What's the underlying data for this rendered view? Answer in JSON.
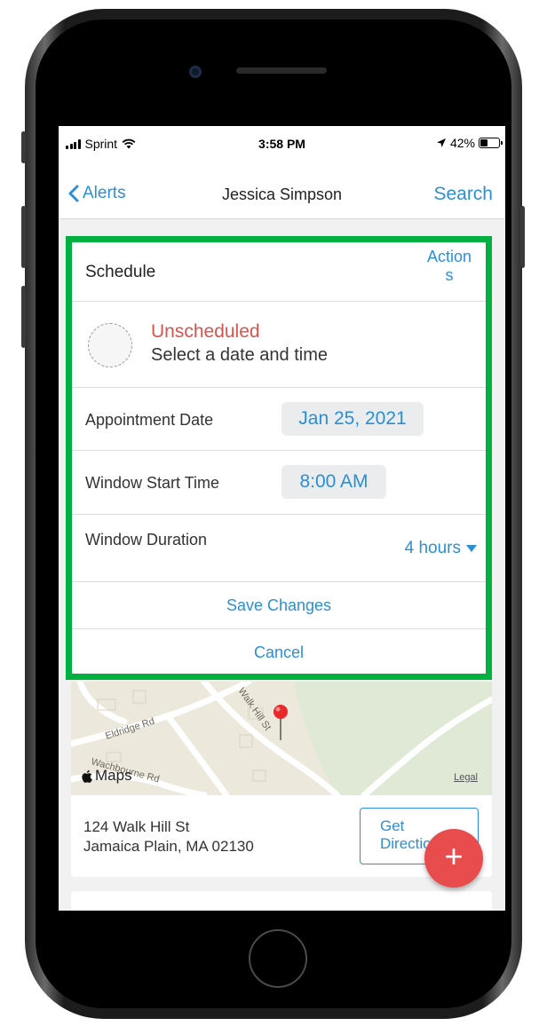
{
  "status_bar": {
    "carrier": "Sprint",
    "time": "3:58 PM",
    "battery": "42%",
    "battery_level": 0.42
  },
  "nav": {
    "back_label": "Alerts",
    "title": "Jessica Simpson",
    "search_label": "Search"
  },
  "schedule": {
    "title": "Schedule",
    "actions_line1": "Action",
    "actions_line2": "s",
    "status": "Unscheduled",
    "status_hint": "Select a date and time",
    "fields": {
      "appointment_date_label": "Appointment Date",
      "appointment_date_value": "Jan 25, 2021",
      "window_start_label": "Window Start Time",
      "window_start_value": "8:00 AM",
      "window_duration_label": "Window Duration",
      "window_duration_value": "4 hours"
    },
    "save_label": "Save Changes",
    "cancel_label": "Cancel"
  },
  "map": {
    "brand": "Maps",
    "legal": "Legal",
    "streets": [
      "Eldridge Rd",
      "Walk Hill St",
      "Wachbourne Rd"
    ]
  },
  "address": {
    "line1": "124 Walk Hill St",
    "line2": "Jamaica Plain, MA 02130",
    "directions_line1": "Get",
    "directions_line2": "Directions"
  },
  "fab": {
    "label": "+"
  },
  "colors": {
    "accent": "#2b8fd6",
    "highlight": "#00b140",
    "unscheduled": "#d9534f",
    "fab": "#e84c4c"
  }
}
